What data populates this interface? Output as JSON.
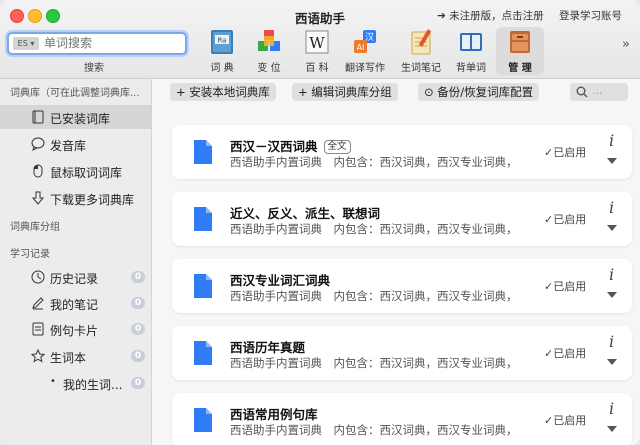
{
  "app": {
    "title": "西语助手",
    "unregistered_link": "➔ 未注册版，点击注册",
    "login_link": "登录学习账号"
  },
  "search": {
    "placeholder": "单词搜索",
    "label": "搜索",
    "dict_selector_icon": "dict-selector-icon"
  },
  "toolbar": {
    "items": [
      {
        "label": "词 典",
        "icon": "dictionary-icon"
      },
      {
        "label": "变 位",
        "icon": "conjugation-cubes-icon"
      },
      {
        "label": "百 科",
        "icon": "wikipedia-icon"
      },
      {
        "label": "翻译写作",
        "icon": "translate-icon"
      },
      {
        "label": "生词笔记",
        "icon": "notepad-icon"
      },
      {
        "label": "背单词",
        "icon": "book-icon"
      },
      {
        "label": "管 理",
        "icon": "manage-box-icon",
        "active": true
      }
    ],
    "overflow": "»"
  },
  "sidebar": {
    "section_library": "词典库（可在此调整词典库...",
    "section_groups": "词典库分组",
    "section_history": "学习记录",
    "library_items": [
      {
        "label": "已安装词库",
        "icon": "dictionary-stack-icon",
        "selected": true
      },
      {
        "label": "发音库",
        "icon": "speech-bubble-icon"
      },
      {
        "label": "鼠标取词词库",
        "icon": "mouse-icon"
      },
      {
        "label": "下载更多词典库",
        "icon": "download-arrow-icon"
      }
    ],
    "history_items": [
      {
        "label": "历史记录",
        "icon": "clock-icon",
        "count": "0"
      },
      {
        "label": "我的笔记",
        "icon": "pencil-icon",
        "count": "0"
      },
      {
        "label": "例句卡片",
        "icon": "card-icon",
        "count": "0"
      },
      {
        "label": "生词本",
        "icon": "star-icon",
        "count": "0"
      },
      {
        "label": "我的生词...",
        "icon": "bullet-icon",
        "count": "0"
      }
    ]
  },
  "main": {
    "buttons": {
      "install": "+ 安装本地词典库",
      "edit_groups": "+ 编辑词典库分组",
      "backup": "⊙ 备份/恢复词库配置"
    },
    "search_placeholder": "...",
    "dictionaries": [
      {
        "title": "西汉－汉西词典",
        "tag": "全文",
        "desc": "西语助手内置词典　内包含：西汉词典，西汉专业词典，",
        "status": "✓已启用"
      },
      {
        "title": "近义、反义、派生、联想词",
        "tag": "",
        "desc": "西语助手内置词典　内包含：西汉词典，西汉专业词典，",
        "status": "✓已启用"
      },
      {
        "title": "西汉专业词汇词典",
        "tag": "",
        "desc": "西语助手内置词典　内包含：西汉词典，西汉专业词典，",
        "status": "✓已启用"
      },
      {
        "title": "西语历年真题",
        "tag": "",
        "desc": "西语助手内置词典　内包含：西汉词典，西汉专业词典，",
        "status": "✓已启用"
      },
      {
        "title": "西语常用例句库",
        "tag": "",
        "desc": "西语助手内置词典　内包含：西汉词典，西汉专业词典，",
        "status": "✓已启用"
      }
    ],
    "info_glyph": "i"
  },
  "colors": {
    "accent_blue": "#2f7cf6",
    "search_focus": "#7aa7ee",
    "badge": "#c9cfd9",
    "close": "#fe5f57",
    "minimize": "#febc2e",
    "maximize": "#28c840"
  }
}
